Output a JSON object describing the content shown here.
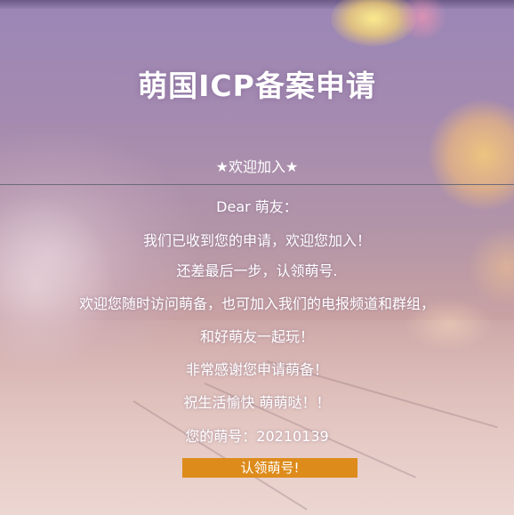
{
  "page": {
    "title": "萌国ICP备案申请",
    "subtitle": "★欢迎加入★"
  },
  "message": {
    "greeting": "Dear 萌友：",
    "lines": [
      "我们已收到您的申请，欢迎您加入！",
      "还差最后一步，认领萌号.",
      "欢迎您随时访问萌备，也可加入我们的电报频道和群组，",
      "和好萌友一起玩！",
      "非常感谢您申请萌备！",
      "祝生活愉快 萌萌哒！！"
    ],
    "number_label": "您的萌号：",
    "number_value": "20210139"
  },
  "actions": {
    "claim_button_label": "认领萌号!"
  },
  "colors": {
    "button_background": "#dd8b1b",
    "text": "#ffffff",
    "divider": "#6b6a78"
  }
}
